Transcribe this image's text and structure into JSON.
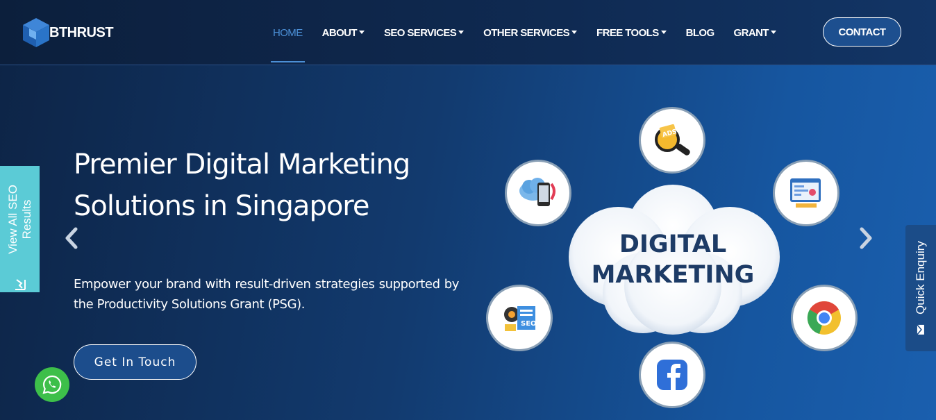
{
  "brand": {
    "name": "BTHRUST"
  },
  "nav": {
    "items": [
      {
        "label": "HOME",
        "active": true,
        "dropdown": false
      },
      {
        "label": "ABOUT",
        "active": false,
        "dropdown": true
      },
      {
        "label": "SEO SERVICES",
        "active": false,
        "dropdown": true
      },
      {
        "label": "OTHER SERVICES",
        "active": false,
        "dropdown": true
      },
      {
        "label": "FREE TOOLS",
        "active": false,
        "dropdown": true
      },
      {
        "label": "BLOG",
        "active": false,
        "dropdown": false
      },
      {
        "label": "GRANT",
        "active": false,
        "dropdown": true
      }
    ],
    "contact_label": "CONTACT"
  },
  "hero": {
    "title": "Premier Digital Marketing Solutions in Singapore",
    "subtitle": "Empower your brand with result-driven strategies supported by the Productivity Solutions Grant (PSG).",
    "cta_label": "Get In Touch"
  },
  "illustration": {
    "center_line1": "DIGITAL",
    "center_line2": "MARKETING",
    "badge_text": "ADS",
    "seo_badge": "SEO",
    "icons": [
      "ads-search-icon",
      "cloud-device-icon",
      "web-analytics-icon",
      "seo-gears-icon",
      "google-chrome-icon",
      "facebook-icon"
    ]
  },
  "side_tabs": {
    "seo_results_line1": "View All SEO",
    "seo_results_line2": "Results",
    "quick_enquiry": "Quick Enquiry"
  },
  "colors": {
    "accent": "#4b8fd6",
    "seo_tab": "#5bcbd6",
    "whatsapp": "#3dbf4a",
    "cloud_text": "#1d3b66"
  }
}
